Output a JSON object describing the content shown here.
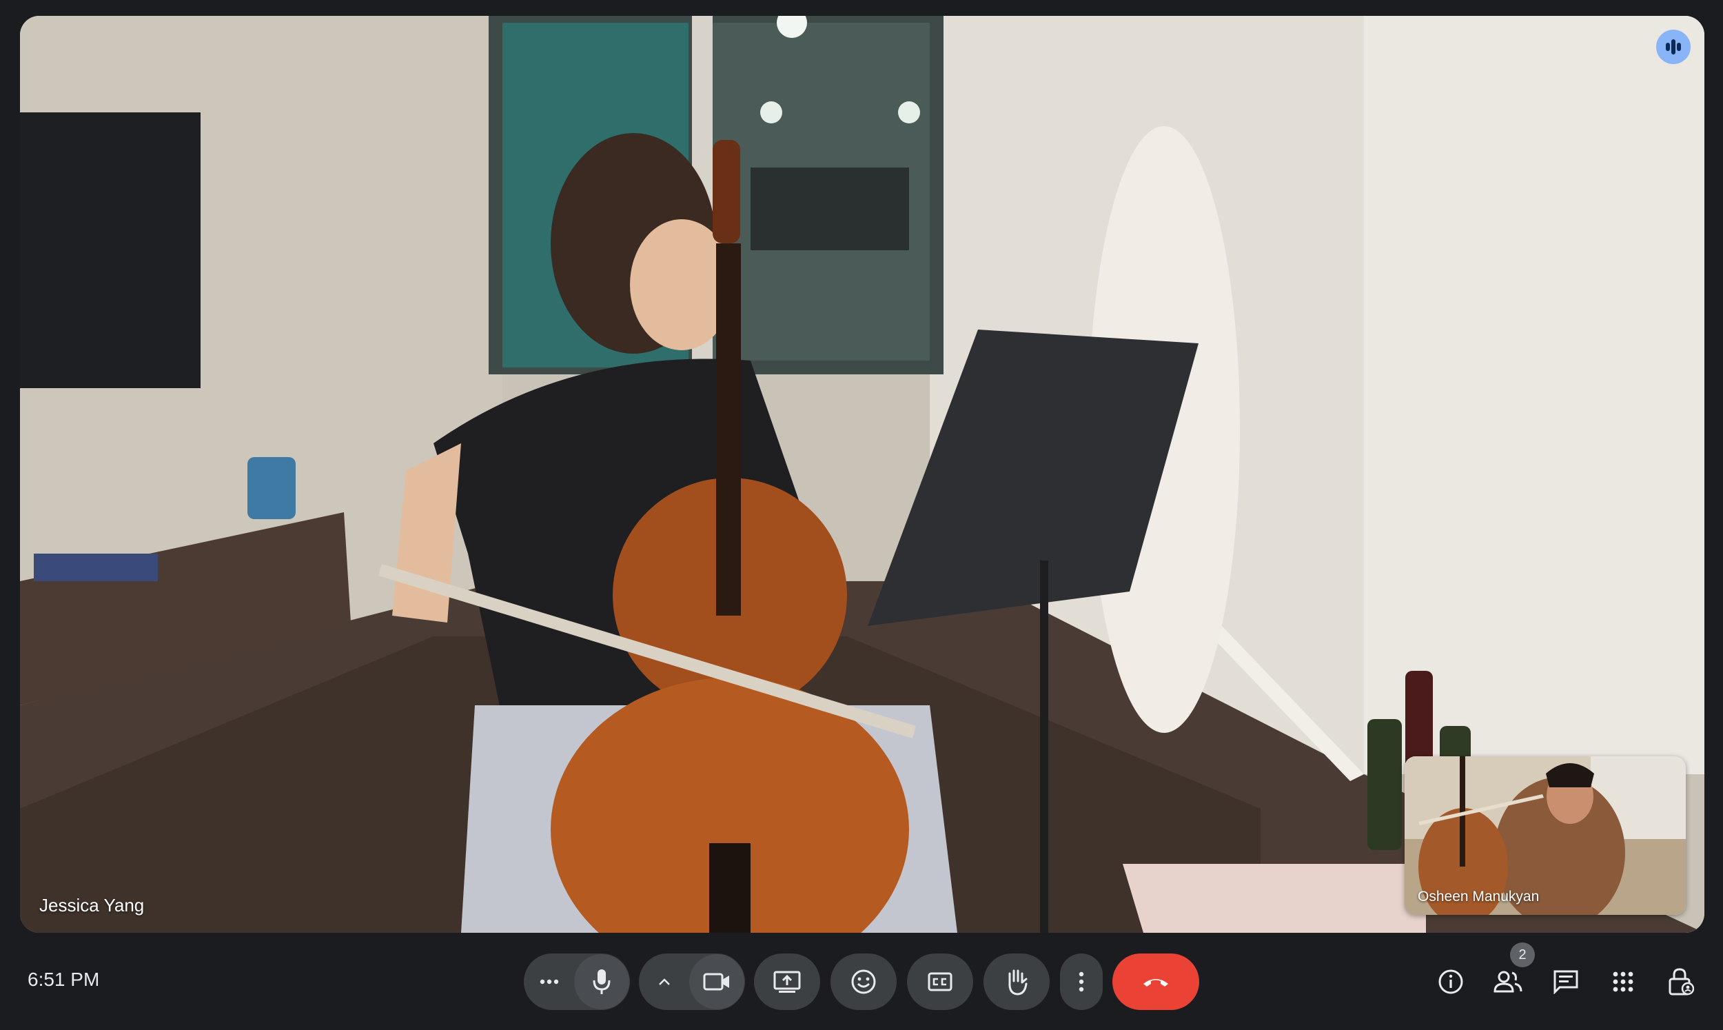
{
  "meeting": {
    "time": "6:51 PM",
    "main_participant": "Jessica Yang",
    "self_participant": "Osheen Manukyan",
    "participant_count": "2"
  },
  "controls": [
    {
      "name": "more-options",
      "icon": "three-dots-horizontal"
    },
    {
      "name": "microphone",
      "icon": "mic-icon"
    },
    {
      "name": "camera-options",
      "icon": "chevron-up-icon"
    },
    {
      "name": "camera",
      "icon": "videocam-icon"
    },
    {
      "name": "present-screen",
      "icon": "present-icon"
    },
    {
      "name": "reactions",
      "icon": "emoji-icon"
    },
    {
      "name": "captions",
      "icon": "cc-icon"
    },
    {
      "name": "raise-hand",
      "icon": "hand-icon"
    },
    {
      "name": "more-actions",
      "icon": "kebab-icon"
    },
    {
      "name": "leave-call",
      "icon": "phone-hangup-icon"
    }
  ],
  "side_controls": [
    {
      "name": "meeting-details",
      "icon": "info-icon"
    },
    {
      "name": "people",
      "icon": "people-icon"
    },
    {
      "name": "chat",
      "icon": "chat-icon"
    },
    {
      "name": "activities",
      "icon": "apps-grid-icon"
    },
    {
      "name": "host-controls",
      "icon": "lock-person-icon"
    }
  ],
  "colors": {
    "background": "#202124",
    "control": "#3c4043",
    "end_call": "#ea4335",
    "speaking": "#8ab4f8",
    "text": "#e8eaed"
  }
}
